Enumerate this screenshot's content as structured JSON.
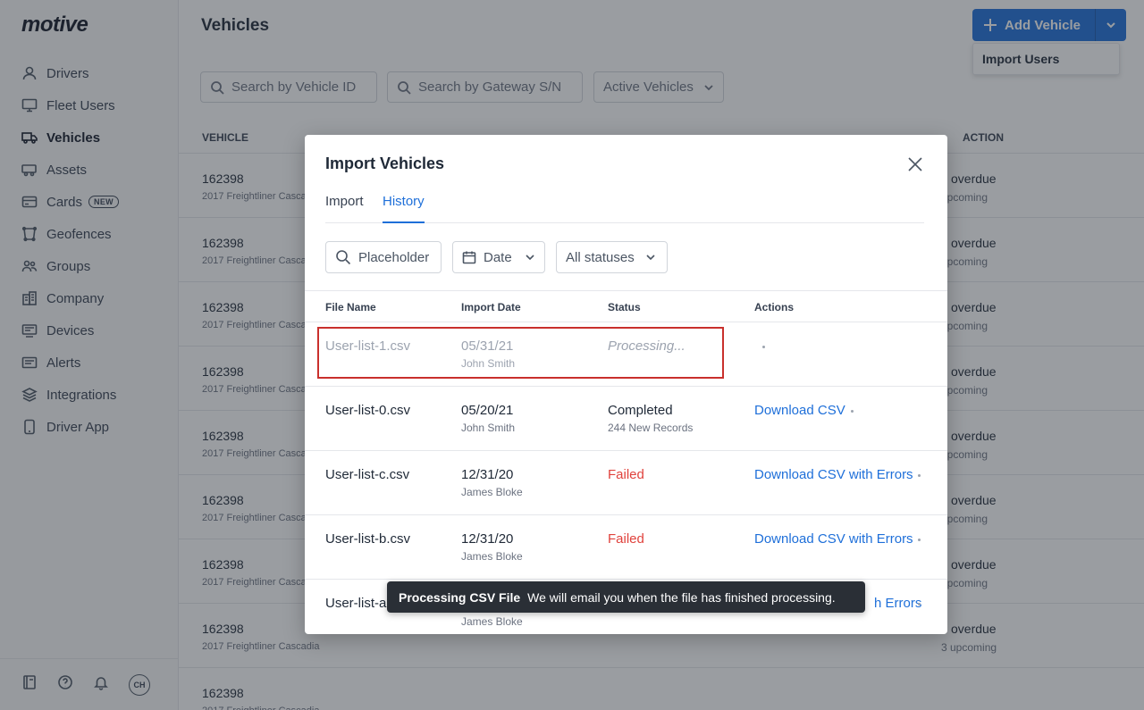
{
  "app": {
    "logo": "motive"
  },
  "sidebar": {
    "items": [
      {
        "label": "Drivers",
        "icon": "user-icon"
      },
      {
        "label": "Fleet Users",
        "icon": "monitor-icon"
      },
      {
        "label": "Vehicles",
        "icon": "truck-icon",
        "active": true
      },
      {
        "label": "Assets",
        "icon": "trailer-icon"
      },
      {
        "label": "Cards",
        "icon": "card-icon",
        "badge": "NEW"
      },
      {
        "label": "Geofences",
        "icon": "geofence-icon"
      },
      {
        "label": "Groups",
        "icon": "groups-icon"
      },
      {
        "label": "Company",
        "icon": "building-icon"
      },
      {
        "label": "Devices",
        "icon": "devices-icon"
      },
      {
        "label": "Alerts",
        "icon": "alerts-icon"
      },
      {
        "label": "Integrations",
        "icon": "layers-icon"
      },
      {
        "label": "Driver App",
        "icon": "phone-icon"
      }
    ],
    "footer": {
      "avatar": "CH"
    }
  },
  "page": {
    "title": "Vehicles",
    "add_vehicle": "Add Vehicle",
    "dropdown_item": "Import Users",
    "filters": {
      "vehicle_id_placeholder": "Search by Vehicle ID",
      "gateway_placeholder": "Search by Gateway S/N",
      "status_filter": "Active Vehicles"
    },
    "table": {
      "col_vehicle": "VEHICLE",
      "col_action": "ACTION",
      "row_id": "162398",
      "row_desc": "2017 Freightliner Cascadia",
      "overdue": "overdue",
      "upcoming": "upcoming",
      "upcoming_last": "3 upcoming"
    }
  },
  "modal": {
    "title": "Import Vehicles",
    "tabs": {
      "import": "Import",
      "history": "History"
    },
    "search_placeholder": "Placeholder",
    "date_filter": "Date",
    "status_filter": "All statuses",
    "columns": {
      "file": "File Name",
      "date": "Import Date",
      "status": "Status",
      "actions": "Actions"
    },
    "rows": [
      {
        "file": "User-list-1.csv",
        "date": "05/31/21",
        "by": "John Smith",
        "status": "Processing...",
        "status_sub": "",
        "action": ""
      },
      {
        "file": "User-list-0.csv",
        "date": "05/20/21",
        "by": "John Smith",
        "status": "Completed",
        "status_sub": "244 New Records",
        "action": "Download CSV"
      },
      {
        "file": "User-list-c.csv",
        "date": "12/31/20",
        "by": "James Bloke",
        "status": "Failed",
        "status_sub": "",
        "action": "Download CSV with Errors"
      },
      {
        "file": "User-list-b.csv",
        "date": "12/31/20",
        "by": "James Bloke",
        "status": "Failed",
        "status_sub": "",
        "action": "Download CSV with Errors"
      },
      {
        "file": "User-list-a",
        "date": "",
        "by": "James Bloke",
        "status": "",
        "status_sub": "",
        "action": "h Errors"
      }
    ]
  },
  "toast": {
    "title": "Processing CSV File",
    "message": "We will email you when the file has finished processing."
  },
  "colors": {
    "accent": "#1e6fd9",
    "failed": "#e0423c",
    "highlight": "#c9302c",
    "toast": "#2a2f36"
  }
}
